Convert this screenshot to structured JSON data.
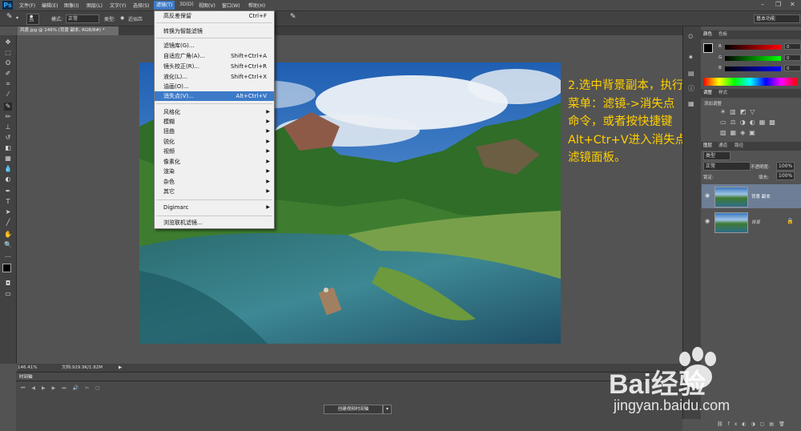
{
  "app": {
    "logo": "Ps"
  },
  "menubar": {
    "items": [
      "文件(F)",
      "编辑(E)",
      "图像(I)",
      "图层(L)",
      "文字(Y)",
      "选择(S)",
      "滤镜(T)",
      "3D(D)",
      "视图(V)",
      "窗口(W)",
      "帮助(H)"
    ],
    "active_item": "滤镜(T)"
  },
  "optionsbar": {
    "size_value": "35",
    "mode_label": "模式:",
    "mode_value": "正常",
    "type_label": "类型:",
    "near_label": "近似匹",
    "workspace_value": "基本功能"
  },
  "document": {
    "tab_title": "风景.jpg @ 146% (背景 副本, RGB/8#) *",
    "zoom": "146.41%",
    "doc_info": "文档:929.9K/1.82M"
  },
  "filter_menu": {
    "items": [
      {
        "label": "高反差保留",
        "shortcut": "Ctrl+F"
      },
      {
        "label": "转换为智能滤镜"
      },
      {
        "label": "滤镜库(G)..."
      },
      {
        "label": "自适应广角(A)...",
        "shortcut": "Shift+Ctrl+A"
      },
      {
        "label": "镜头校正(R)...",
        "shortcut": "Shift+Ctrl+R"
      },
      {
        "label": "液化(L)...",
        "shortcut": "Shift+Ctrl+X"
      },
      {
        "label": "油画(O)..."
      },
      {
        "label": "消失点(V)...",
        "shortcut": "Alt+Ctrl+V",
        "highlighted": true
      },
      {
        "label": "风格化",
        "submenu": true
      },
      {
        "label": "模糊",
        "submenu": true
      },
      {
        "label": "扭曲",
        "submenu": true
      },
      {
        "label": "锐化",
        "submenu": true
      },
      {
        "label": "视频",
        "submenu": true
      },
      {
        "label": "像素化",
        "submenu": true
      },
      {
        "label": "渲染",
        "submenu": true
      },
      {
        "label": "杂色",
        "submenu": true
      },
      {
        "label": "其它",
        "submenu": true
      },
      {
        "label": "Digimarc",
        "submenu": true
      },
      {
        "label": "浏览联机滤镜..."
      }
    ]
  },
  "annotation": {
    "lines": [
      "2.选中背景副本，执行",
      "菜单：滤镜->消失点",
      "命令，或者按快捷键",
      "Alt+Ctr+V进入消失点",
      "滤镜面板。"
    ]
  },
  "color_panel": {
    "tabs": [
      "颜色",
      "色板"
    ],
    "channels": [
      {
        "name": "R",
        "value": "0"
      },
      {
        "name": "G",
        "value": "0"
      },
      {
        "name": "B",
        "value": "0"
      }
    ]
  },
  "adjust_panel": {
    "tabs": [
      "调整",
      "样式"
    ],
    "title": "添加调整"
  },
  "layers_panel": {
    "tabs": [
      "图层",
      "通道",
      "路径"
    ],
    "kind_value": "类型",
    "blend_value": "正常",
    "opacity_label": "不透明度:",
    "opacity_value": "100%",
    "lock_label": "锁定:",
    "fill_label": "填充:",
    "fill_value": "100%",
    "layers": [
      {
        "name": "背景 副本",
        "selected": true
      },
      {
        "name": "背景",
        "locked": true
      }
    ]
  },
  "timeline": {
    "tab": "时间轴",
    "create_button": "创建视频时间轴"
  },
  "watermark": {
    "brand": "Bai经验",
    "url": "jingyan.baidu.com"
  },
  "colors": {
    "menu_highlight": "#3c7ac8",
    "annotation": "#ffd000",
    "ui_bg": "#535353",
    "menu_bg": "#f0f0f0"
  }
}
